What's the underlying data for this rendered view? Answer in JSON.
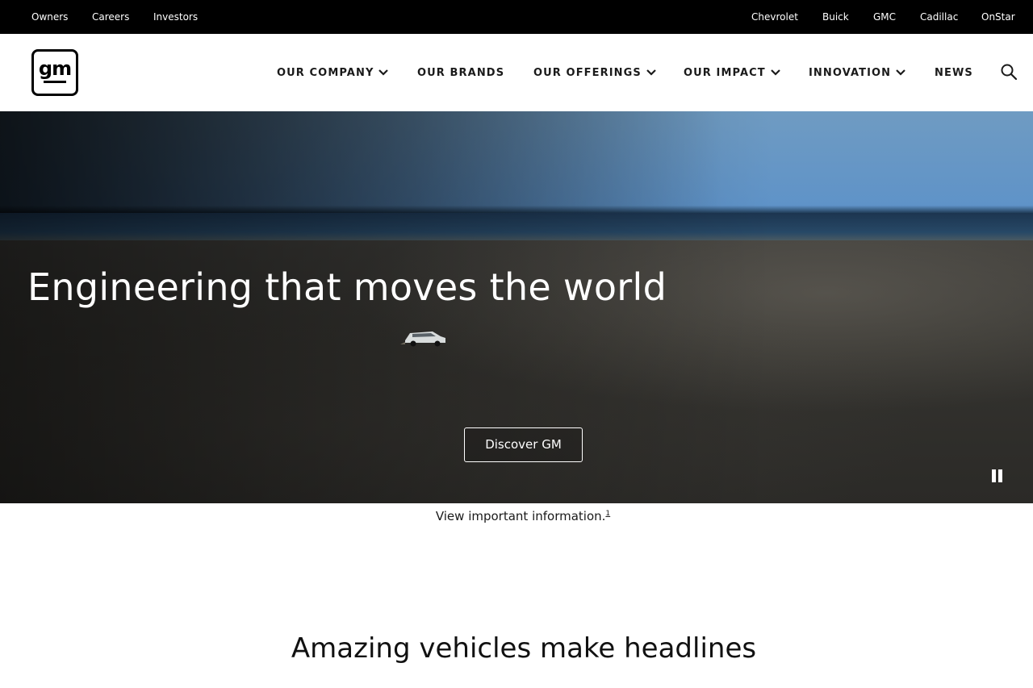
{
  "utility_nav": {
    "left": [
      "Owners",
      "Careers",
      "Investors"
    ],
    "right": [
      "Chevrolet",
      "Buick",
      "GMC",
      "Cadillac",
      "OnStar"
    ]
  },
  "header": {
    "logo_text": "gm",
    "nav": [
      {
        "label": "OUR COMPANY",
        "dropdown": true
      },
      {
        "label": "OUR BRANDS",
        "dropdown": false
      },
      {
        "label": "OUR OFFERINGS",
        "dropdown": true
      },
      {
        "label": "OUR IMPACT",
        "dropdown": true
      },
      {
        "label": "INNOVATION",
        "dropdown": true
      },
      {
        "label": "NEWS",
        "dropdown": false
      }
    ],
    "search_icon": "search-icon"
  },
  "hero": {
    "title": "Engineering that moves the world",
    "cta_label": "Discover GM",
    "pause_icon": "pause-icon"
  },
  "info": {
    "text": "View important information.",
    "footnote": "1"
  },
  "section": {
    "heading": "Amazing vehicles make headlines"
  },
  "colors": {
    "utility_bar_bg": "#000000",
    "header_bg": "#ffffff",
    "text_dark": "#1a1a1a",
    "hero_text": "#ffffff"
  }
}
